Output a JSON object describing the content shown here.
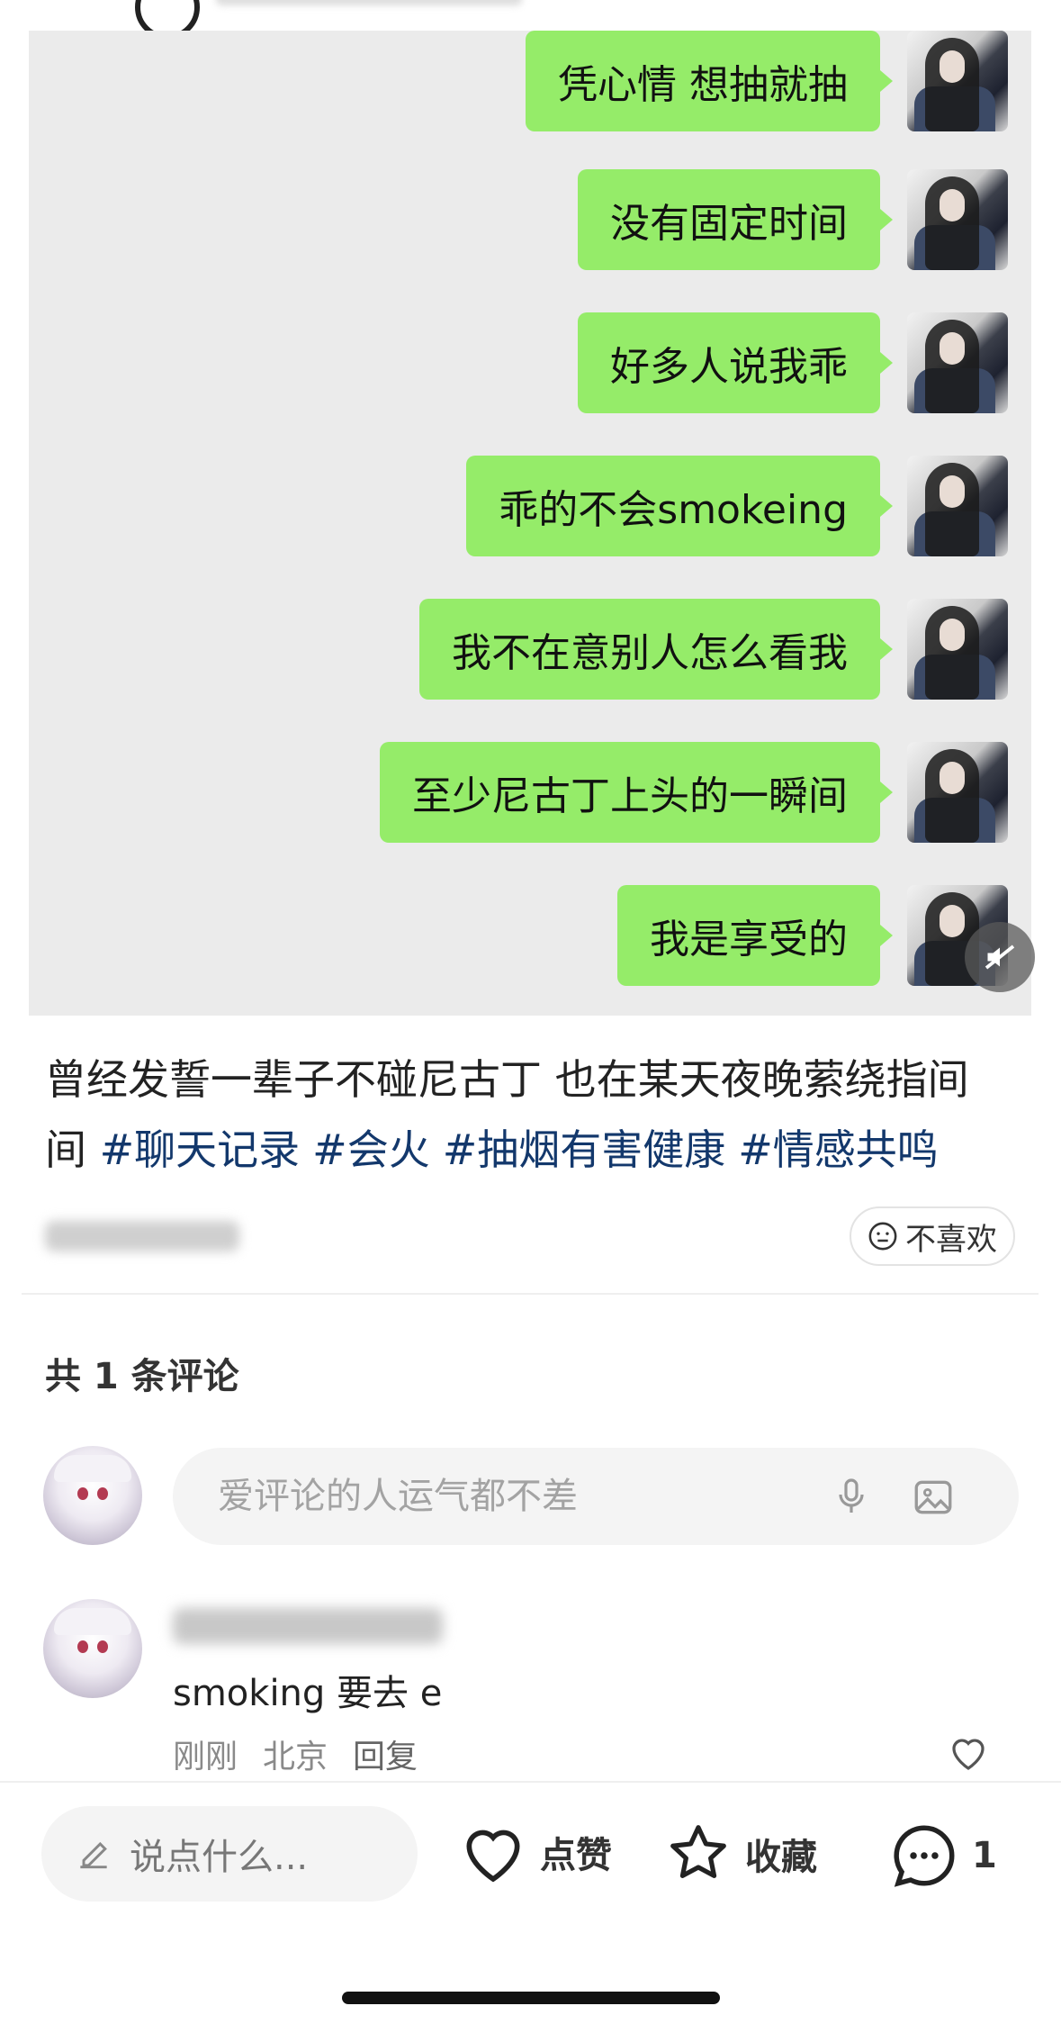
{
  "chat_screenshot": {
    "messages": [
      "凭心情 想抽就抽",
      "没有固定时间",
      "好多人说我乖",
      "乖的不会smokeing",
      "我不在意别人怎么看我",
      "至少尼古丁上头的一瞬间",
      "我是享受的"
    ]
  },
  "post": {
    "caption_text": "曾经发誓一辈子不碰尼古丁 也在某天夜晚萦绕指间",
    "tags": [
      "#聊天记录",
      "#会火",
      "#抽烟有害健康",
      "#情感共鸣"
    ],
    "dislike_label": "不喜欢"
  },
  "comments": {
    "count_label": "共 1 条评论",
    "input_placeholder": "爱评论的人运气都不差",
    "items": [
      {
        "text": "smoking 要去 e",
        "time": "刚刚",
        "location": "北京",
        "reply_label": "回复"
      }
    ]
  },
  "bottom_bar": {
    "say_placeholder": "说点什么...",
    "like_label": "点赞",
    "collect_label": "收藏",
    "comment_count": "1"
  },
  "colors": {
    "bubble_green": "#95ec69",
    "tag_blue": "#13386c"
  }
}
